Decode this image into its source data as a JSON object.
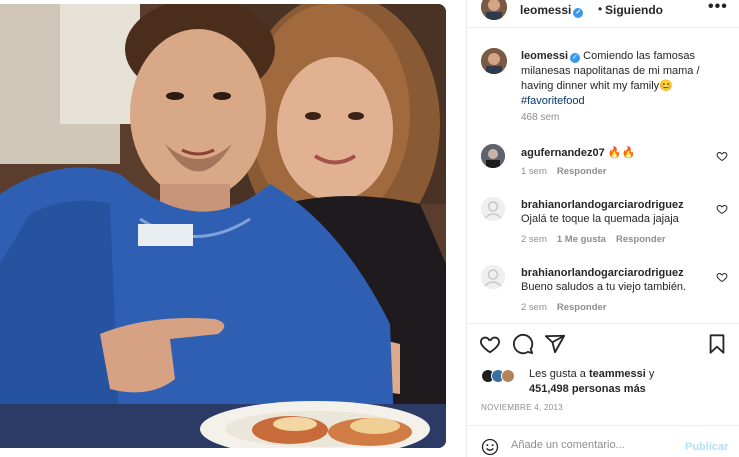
{
  "post": {
    "username": "leomessi",
    "verified_mark": "✓",
    "dot": "•",
    "follow_state": "Siguiendo",
    "more_icon": "more-horizontal-icon",
    "caption": {
      "username": "leomessi",
      "text": "Comiendo las famosas milanesas napolitanas de mi mama / having dinner whit my family",
      "emoji": "😊",
      "hashtag": "#favoritefood",
      "time": "468 sem"
    },
    "comments": [
      {
        "username": "agufernandez07",
        "text": "🔥🔥",
        "time": "1 sem",
        "reply": "Responder",
        "likes": ""
      },
      {
        "username": "brahianorlandogarciarodriguez",
        "text": "Ojalá te toque la quemada jajaja",
        "time": "2 sem",
        "likes": "1 Me gusta",
        "reply": "Responder"
      },
      {
        "username": "brahianorlandogarciarodriguez",
        "text": "Bueno saludos a tu viejo también.",
        "time": "2 sem",
        "reply": "Responder",
        "likes": ""
      }
    ],
    "likes": {
      "prefix": "Les gusta a",
      "first_user": "teammessi",
      "connector": "y",
      "count_text": "451,498 personas más"
    },
    "date": "NOVIEMBRE 4, 2013",
    "add_comment": {
      "placeholder": "Añade un comentario...",
      "publish_label": "Publicar"
    },
    "icons": {
      "like": "heart-icon",
      "comment": "comment-icon",
      "share": "send-icon",
      "save": "bookmark-icon",
      "emoji": "emoji-icon"
    },
    "colors": {
      "text": "#262626",
      "muted": "#8e8e8e",
      "hashtag": "#00376b",
      "verified": "#3897f0",
      "publish_disabled": "#b2dffc",
      "divider": "#efefef"
    }
  }
}
